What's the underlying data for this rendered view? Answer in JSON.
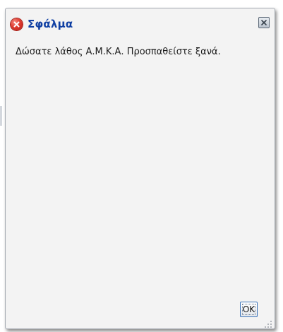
{
  "dialog": {
    "title": "Σφάλμα",
    "message": "Δώσατε λάθος Α.Μ.Κ.Α. Προσπαθείστε ξανά.",
    "ok_label": "OK",
    "icons": {
      "status": "error-icon",
      "close": "close-icon",
      "resize": "resize-grip-icon"
    }
  },
  "colors": {
    "title": "#0f3fa3",
    "dialog_background": "#f3f3f3",
    "error": "#df3b30",
    "button_border": "#3b73b9"
  }
}
